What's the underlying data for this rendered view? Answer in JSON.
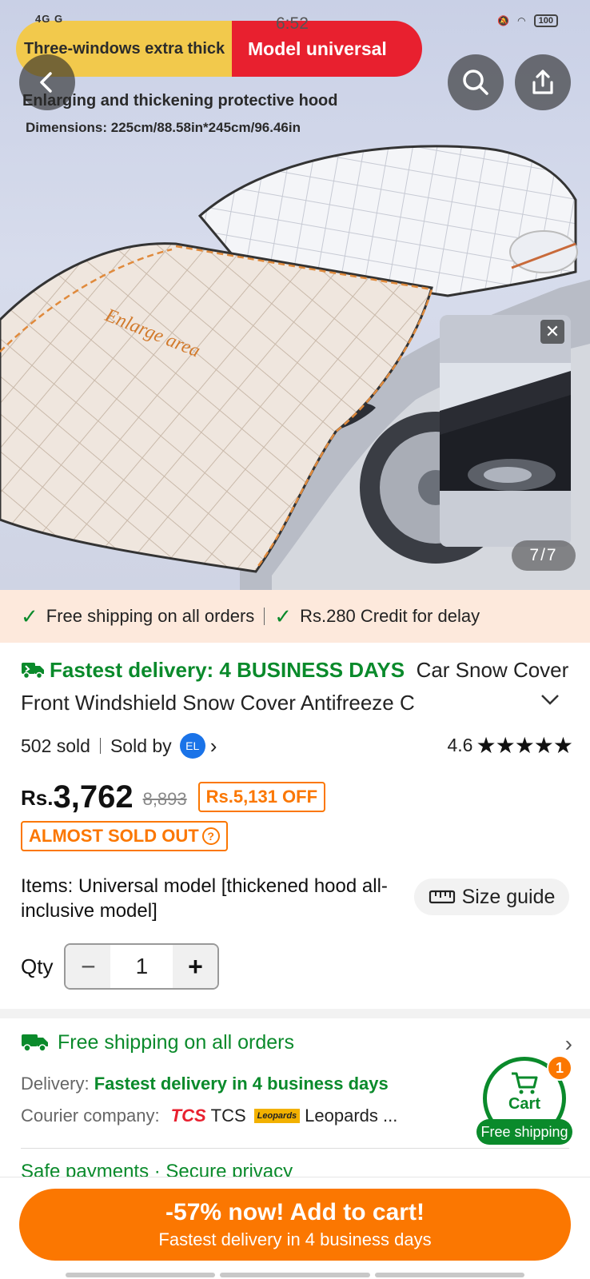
{
  "status_bar": {
    "network": "4G G",
    "time": "6:52",
    "battery": "100"
  },
  "hero": {
    "pill_left": "Three-windows extra thick",
    "pill_right": "Model universal",
    "subtitle": "Enlarging and thickening protective hood",
    "dimensions": "Dimensions: 225cm/88.58in*245cm/96.46in",
    "enlarge_label": "Enlarge area",
    "counter": "7/7",
    "pip_close": "✕"
  },
  "banner": {
    "left": "Free shipping on all orders",
    "right": "Rs.280 Credit for delay"
  },
  "product": {
    "fast_label": "Fastest delivery: 4 BUSINESS DAYS",
    "title": "Car Snow Cover Front Windshield Snow Cover Antifreeze C",
    "sold": "502 sold",
    "sold_by": "Sold by",
    "seller_badge": "EL",
    "rating": "4.6",
    "stars": "★★★★★"
  },
  "price": {
    "currency": "Rs.",
    "now": "3,762",
    "old": "8,893",
    "off": "Rs.5,131 OFF",
    "stock": "ALMOST SOLD OUT"
  },
  "options": {
    "items_label": "Items:",
    "items_value": "Universal model [thickened hood all-inclusive model]",
    "size_guide": "Size guide",
    "qty_label": "Qty",
    "qty_value": "1",
    "minus": "−",
    "plus": "+"
  },
  "shipping": {
    "free": "Free shipping on all orders",
    "delivery_label": "Delivery:",
    "delivery_value": "Fastest delivery in 4 business days",
    "courier_label": "Courier company:",
    "tcs_logo": "TCS",
    "tcs_name": "TCS",
    "leo_logo": "Leopards",
    "leo_name": "Leopards ...",
    "safe": "Safe payments · Secure privacy"
  },
  "cart": {
    "label": "Cart",
    "count": "1",
    "ship": "Free shipping"
  },
  "cta": {
    "main": "-57% now! Add to cart!",
    "sub": "Fastest delivery in 4 business days"
  },
  "colors": {
    "accent": "#fb7701",
    "green": "#0a8a2b",
    "red": "#e8202f"
  }
}
